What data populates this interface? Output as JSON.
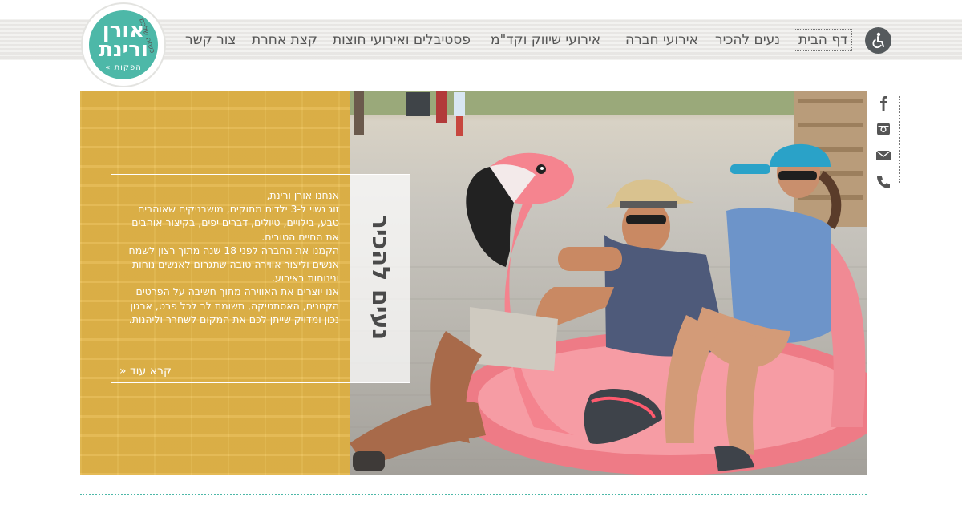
{
  "header": {
    "logo": {
      "line1": "אורן",
      "line2": "ורינת",
      "line3": "הפקות",
      "tagline": "כשזה שלכם"
    },
    "nav": [
      {
        "id": "home",
        "label": "דף הבית",
        "active": true
      },
      {
        "id": "about",
        "label": "נעים להכיר"
      },
      {
        "id": "corp",
        "label": "אירועי חברה"
      },
      {
        "id": "mkt",
        "label": "אירועי שיווק וקד\"מ"
      },
      {
        "id": "fest",
        "label": "פסטיבלים ואירועי חוצות"
      },
      {
        "id": "other",
        "label": "קצת אחרת"
      },
      {
        "id": "contact",
        "label": "צור קשר"
      }
    ],
    "accessibility_icon": "wheelchair-icon"
  },
  "social": [
    "facebook-icon",
    "instagram-icon",
    "email-icon",
    "phone-icon"
  ],
  "hero": {
    "title": "נעים להכיר",
    "paragraphs": [
      "אנחנו אורן ורינת,",
      "זוג נשוי ל-3 ילדים מתוקים, מושבניקים שאוהבים טבע, בילויים, טיולים, דברים יפים, בקיצור אוהבים את החיים הטובים.",
      "הקמנו את החברה לפני 18 שנה מתוך רצון לשמח אנשים וליצור אווירה טובה שתגרום לאנשים נוחות ונינוחות באירוע.",
      "אנו יוצרים את האווירה מתוך חשיבה על הפרטים הקטנים, האסתטיקה, תשומת לב לכל פרט, ארגון נכון ומדויק שייתן לכם את המקום לשחרר וליהנות."
    ],
    "read_more": "קרא עוד",
    "photo": "couple-on-pink-flamingo-photo"
  },
  "colors": {
    "accent": "#4db8a8",
    "yellow": "#e7b94a",
    "header_bg": "#ecebe8",
    "text": "#4a4a4a"
  }
}
